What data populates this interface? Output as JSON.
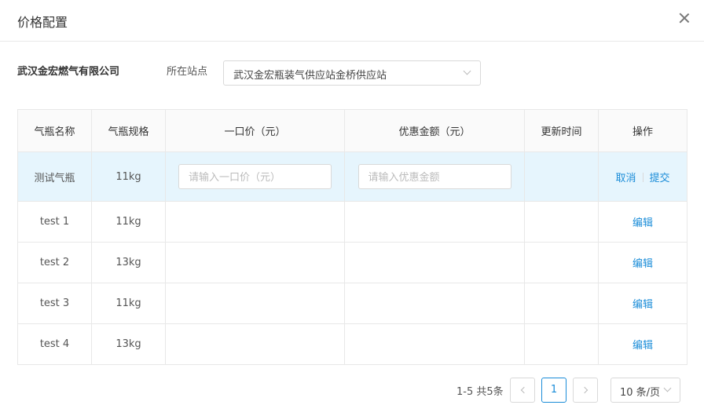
{
  "dialog": {
    "title": "价格配置"
  },
  "filter": {
    "company": "武汉金宏燃气有限公司",
    "station_label": "所在站点",
    "station_value": "武汉金宏瓶装气供应站金桥供应站"
  },
  "table": {
    "headers": [
      "气瓶名称",
      "气瓶规格",
      "一口价（元）",
      "优惠金额（元）",
      "更新时间",
      "操作"
    ],
    "editing_row": {
      "name": "测试气瓶",
      "spec": "11kg",
      "price_placeholder": "请输入一口价（元）",
      "discount_placeholder": "请输入优惠金额",
      "update_time": "",
      "cancel_label": "取消",
      "submit_label": "提交"
    },
    "rows": [
      {
        "name": "test 1",
        "spec": "11kg",
        "price": "",
        "discount": "",
        "update_time": "",
        "action": "编辑"
      },
      {
        "name": "test 2",
        "spec": "13kg",
        "price": "",
        "discount": "",
        "update_time": "",
        "action": "编辑"
      },
      {
        "name": "test 3",
        "spec": "11kg",
        "price": "",
        "discount": "",
        "update_time": "",
        "action": "编辑"
      },
      {
        "name": "test 4",
        "spec": "13kg",
        "price": "",
        "discount": "",
        "update_time": "",
        "action": "编辑"
      }
    ]
  },
  "pagination": {
    "total_text": "1-5 共5条",
    "current_page": "1",
    "page_size": "10 条/页"
  },
  "colors": {
    "accent": "#1a8cd8",
    "editing_row_bg": "#e6f5fd",
    "header_bg": "#fafafa"
  }
}
